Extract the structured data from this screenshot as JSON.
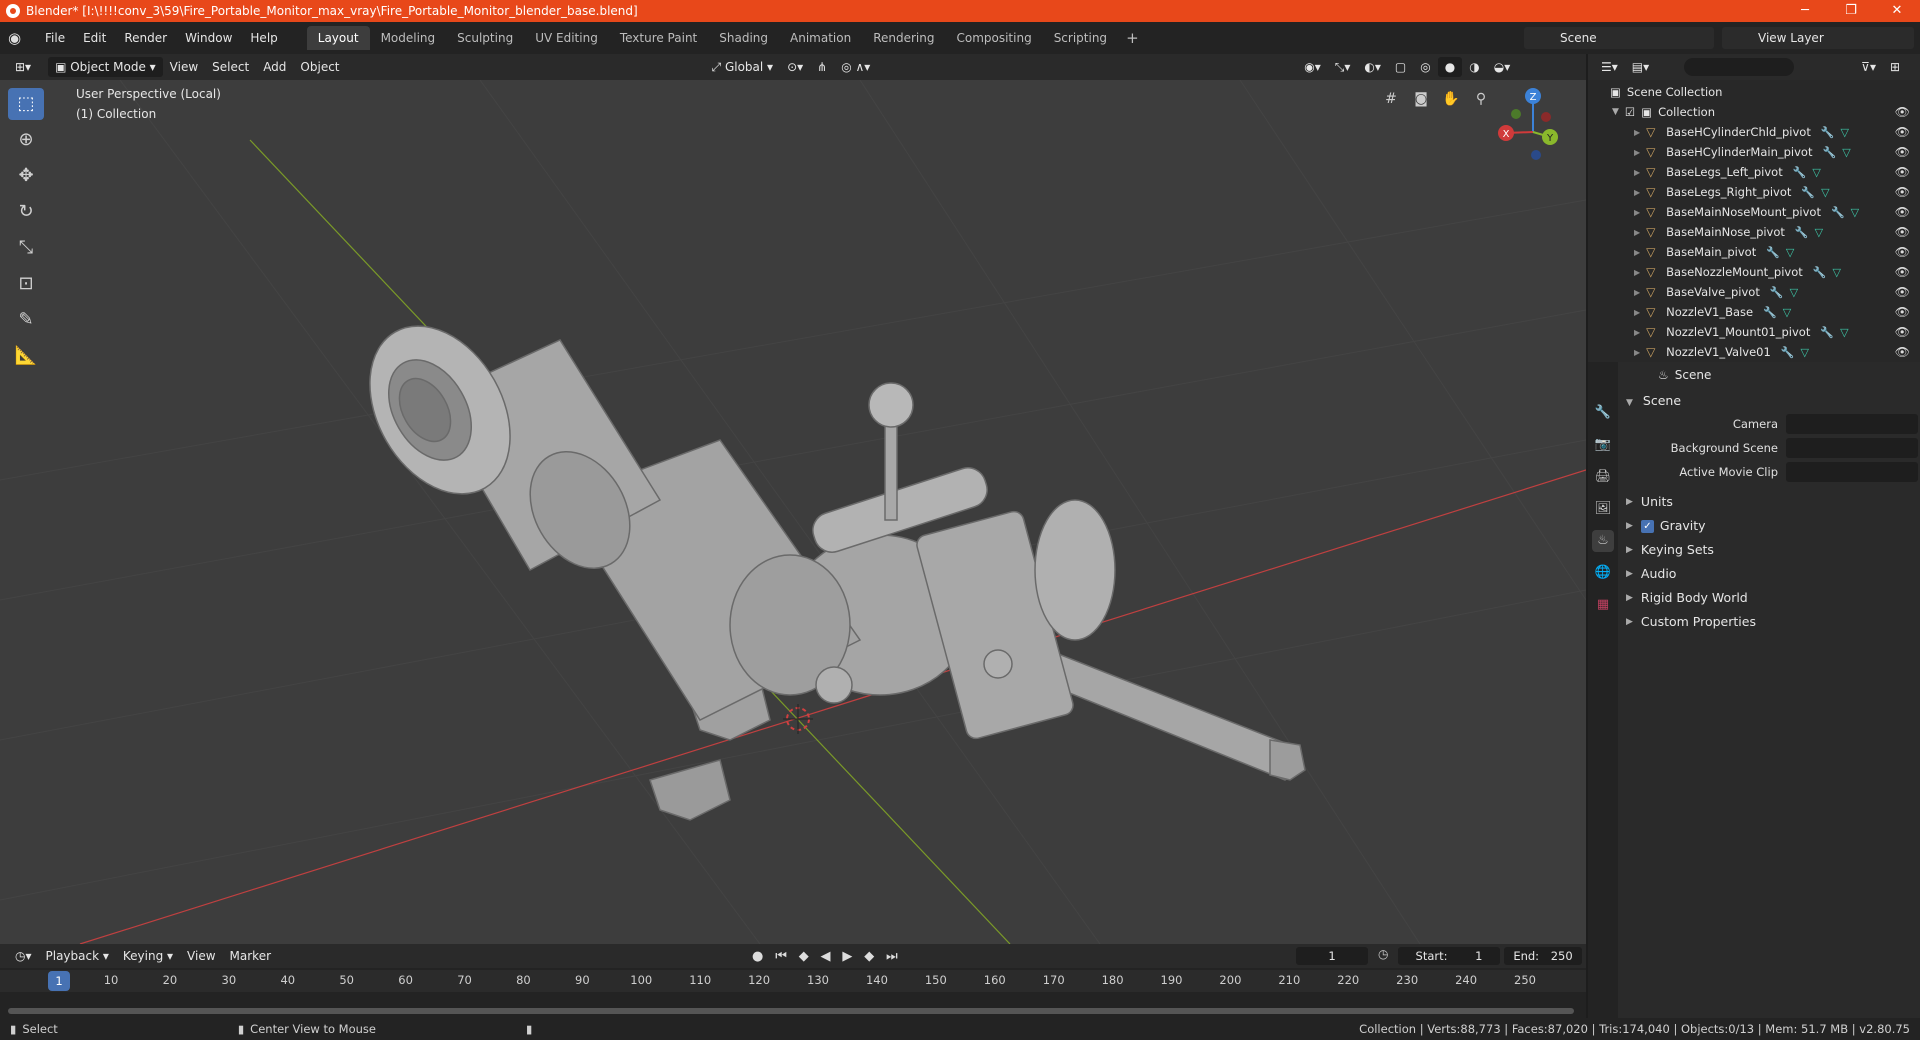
{
  "window": {
    "title": "Blender* [I:\\!!!!conv_3\\59\\Fire_Portable_Monitor_max_vray\\Fire_Portable_Monitor_blender_base.blend]",
    "minimize": "─",
    "maximize": "❐",
    "close": "✕"
  },
  "menubar": {
    "items": [
      "File",
      "Edit",
      "Render",
      "Window",
      "Help"
    ]
  },
  "workspaces": {
    "tabs": [
      "Layout",
      "Modeling",
      "Sculpting",
      "UV Editing",
      "Texture Paint",
      "Shading",
      "Animation",
      "Rendering",
      "Compositing",
      "Scripting"
    ],
    "active": "Layout",
    "add": "+"
  },
  "scene_selector": {
    "value": "Scene"
  },
  "layer_selector": {
    "value": "View Layer"
  },
  "viewport_header": {
    "mode": "Object Mode",
    "menus": [
      "View",
      "Select",
      "Add",
      "Object"
    ],
    "orientation": "Global"
  },
  "viewport": {
    "perspective": "User Perspective (Local)",
    "collection": "(1) Collection"
  },
  "gizmo": {
    "x": "X",
    "y": "Y",
    "z": "Z"
  },
  "outliner": {
    "root": "Scene Collection",
    "collection": "Collection",
    "items": [
      "BaseHCylinderChld_pivot",
      "BaseHCylinderMain_pivot",
      "BaseLegs_Left_pivot",
      "BaseLegs_Right_pivot",
      "BaseMainNoseMount_pivot",
      "BaseMainNose_pivot",
      "BaseMain_pivot",
      "BaseNozzleMount_pivot",
      "BaseValve_pivot",
      "NozzleV1_Base",
      "NozzleV1_Mount01_pivot",
      "NozzleV1_Valve01"
    ]
  },
  "properties": {
    "header": "Scene",
    "panel": "Scene",
    "fields": [
      {
        "label": "Camera",
        "value": ""
      },
      {
        "label": "Background Scene",
        "value": ""
      },
      {
        "label": "Active Movie Clip",
        "value": ""
      }
    ],
    "subpanels": [
      "Units",
      "Gravity",
      "Keying Sets",
      "Audio",
      "Rigid Body World",
      "Custom Properties"
    ]
  },
  "timeline": {
    "menus": [
      "Playback",
      "Keying",
      "View",
      "Marker"
    ],
    "current_frame": "1",
    "start_label": "Start:",
    "start": "1",
    "end_label": "End:",
    "end": "250",
    "ruler": [
      "1",
      "10",
      "20",
      "30",
      "40",
      "50",
      "60",
      "70",
      "80",
      "90",
      "100",
      "110",
      "120",
      "130",
      "140",
      "150",
      "160",
      "170",
      "180",
      "190",
      "200",
      "210",
      "220",
      "230",
      "240",
      "250"
    ]
  },
  "statusbar": {
    "left1": "Select",
    "left2": "Center View to Mouse",
    "right": "Collection | Verts:88,773 | Faces:87,020 | Tris:174,040 | Objects:0/13 | Mem: 51.7 MB | v2.80.75"
  },
  "colors": {
    "accent": "#4772b3",
    "titlebar": "#e8481a",
    "x_axis": "#d03a3a",
    "y_axis": "#8ab82c",
    "z_axis": "#3c82d8"
  }
}
